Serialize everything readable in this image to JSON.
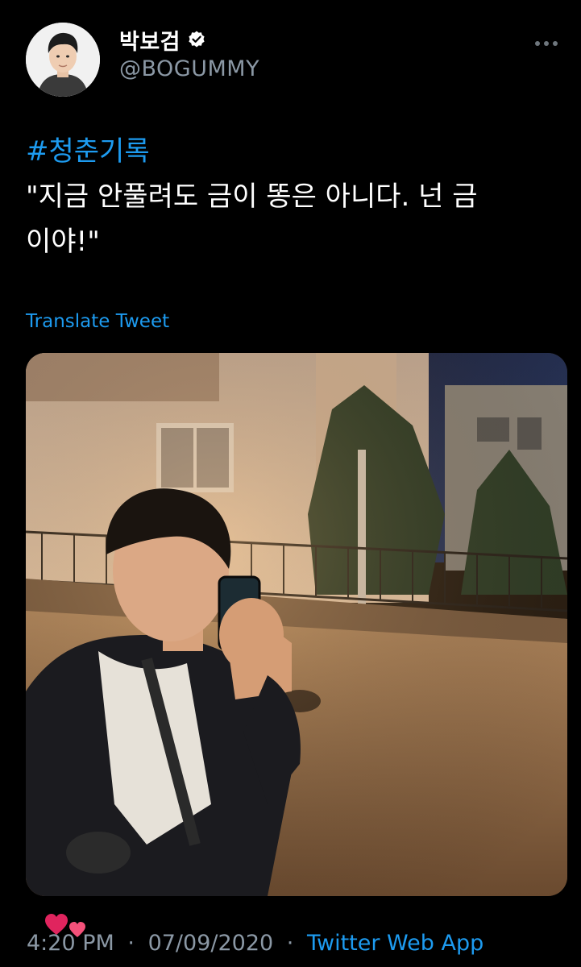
{
  "user": {
    "display_name": "박보검",
    "handle": "@BOGUMMY",
    "verified": true,
    "avatar_icon": "profile-photo"
  },
  "tweet": {
    "hashtag": "#청춘기록",
    "text": "\"지금 안풀려도 금이 똥은 아니다. 넌 금\n이야!\"",
    "translate_label": "Translate Tweet",
    "media_alt": "night selfie photo"
  },
  "meta": {
    "time": "4:20 PM",
    "separator": "·",
    "date": "07/09/2020",
    "source": "Twitter Web App"
  },
  "colors": {
    "background": "#000000",
    "accent": "#1d9bf0",
    "secondary_text": "#8b98a5",
    "primary_text": "#ffffff",
    "heart": "#e0245e"
  }
}
